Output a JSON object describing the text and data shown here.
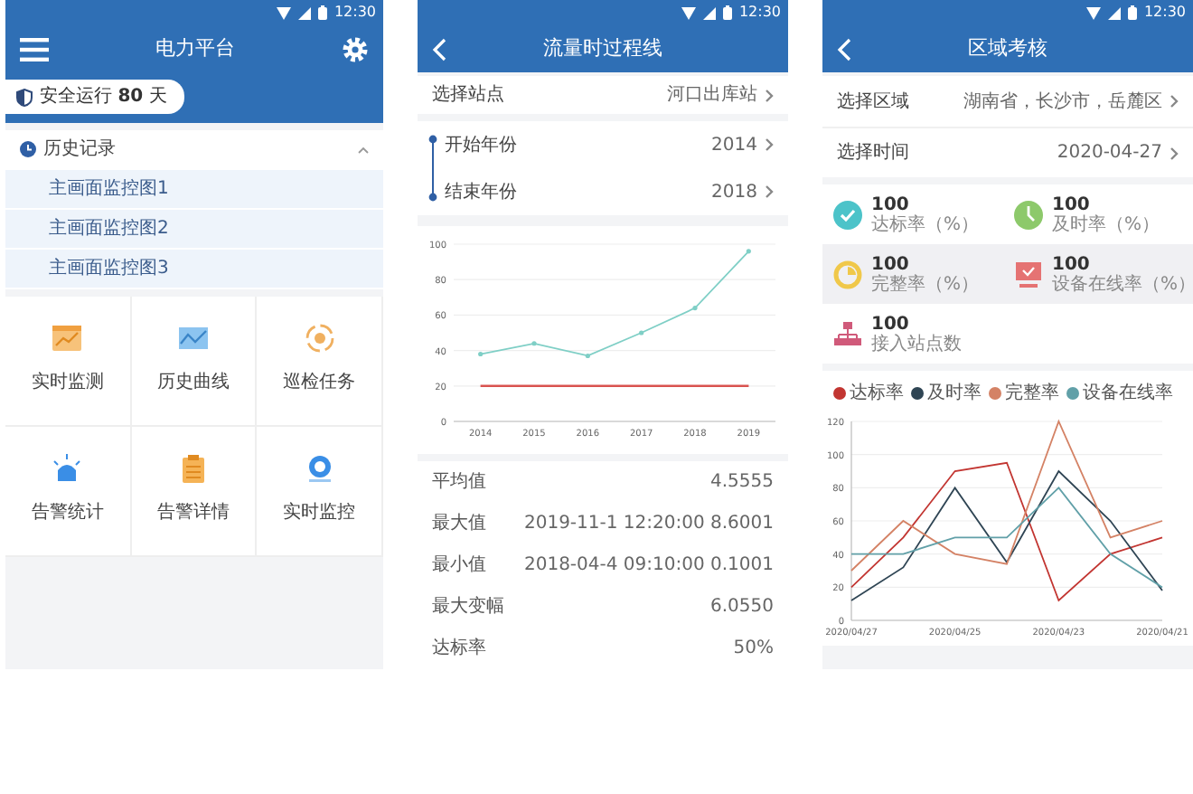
{
  "home": {
    "status_bar": {
      "time": "12:30"
    },
    "title": "电力平台",
    "safety_badge": "安全运行 **80** 天",
    "history": {
      "title": "历史记录",
      "expanded": true,
      "items": [
        "主画面监控图1",
        "主画面监控图2",
        "主画面监控图3"
      ]
    },
    "tiles": [
      {
        "label": "实时监测",
        "kind": "board"
      },
      {
        "label": "历史曲线",
        "kind": "curve"
      },
      {
        "label": "巡检任务",
        "kind": "eye"
      },
      {
        "label": "告警统计",
        "kind": "siren"
      },
      {
        "label": "告警详情",
        "kind": "clipboard"
      },
      {
        "label": "实时监控",
        "kind": "camera"
      }
    ]
  },
  "flow_screen": {
    "status_bar": {
      "time": "12:30"
    },
    "title": "流量时过程线",
    "station": {
      "label": "选择站点",
      "value": "河口出库站"
    },
    "start_year": {
      "label": "开始年份",
      "value": "2014"
    },
    "end_year": {
      "label": "结束年份",
      "value": "2018"
    },
    "chart_data": {
      "type": "line",
      "grid": true,
      "categories": [
        "2014",
        "2015",
        "2016",
        "2017",
        "2018",
        "2019"
      ],
      "ylim": [
        0,
        100
      ],
      "yticks": [
        0,
        20,
        40,
        60,
        80,
        100
      ],
      "series": [
        {
          "color": "#7fcfc6",
          "values": [
            38,
            44,
            37,
            50,
            64,
            96
          ]
        },
        {
          "color": "#d9534f",
          "values": [
            20,
            20,
            20,
            20,
            20,
            20
          ]
        }
      ]
    },
    "stats": [
      {
        "label": "平均值",
        "value": "4.5555"
      },
      {
        "label": "最大值",
        "time": "2019-11-1 12:20:00",
        "value": "8.6001"
      },
      {
        "label": "最小值",
        "time": "2018-04-4 09:10:00",
        "value": "0.1001"
      },
      {
        "label": "最大变幅",
        "value": "6.0550"
      },
      {
        "label": "达标率",
        "value": "50%"
      }
    ]
  },
  "region_screen": {
    "status_bar": {
      "time": "12:30"
    },
    "title": "区域考核",
    "region": {
      "label": "选择区域",
      "value": "湖南省，长沙市，岳麓区"
    },
    "time": {
      "label": "选择时间",
      "value": "2020-04-27"
    },
    "metrics": [
      {
        "value": "100",
        "label": "达标率（%）",
        "kind": "check"
      },
      {
        "value": "100",
        "label": "及时率（%）",
        "kind": "clock"
      },
      {
        "value": "100",
        "label": "完整率（%）",
        "kind": "pie"
      },
      {
        "value": "100",
        "label": "设备在线率（%）",
        "kind": "monitor"
      },
      {
        "value": "100",
        "label": "接入站点数",
        "kind": "network"
      }
    ],
    "chart_data": {
      "type": "line",
      "grid": true,
      "categories": [
        "2020/04/27",
        null,
        "2020/04/25",
        null,
        "2020/04/23",
        null,
        "2020/04/21"
      ],
      "ylim": [
        0,
        120
      ],
      "yticks": [
        0,
        20,
        40,
        60,
        80,
        100,
        120
      ],
      "series": [
        {
          "name": "达标率",
          "color": "#c23531",
          "values": [
            20,
            50,
            90,
            95,
            12,
            40,
            50
          ]
        },
        {
          "name": "及时率",
          "color": "#2f4554",
          "values": [
            12,
            32,
            80,
            35,
            90,
            60,
            18
          ]
        },
        {
          "name": "完整率",
          "color": "#d48265",
          "values": [
            30,
            60,
            40,
            34,
            120,
            50,
            60
          ]
        },
        {
          "name": "设备在线率",
          "color": "#61a0a8",
          "values": [
            40,
            40,
            50,
            50,
            80,
            40,
            20
          ]
        }
      ]
    }
  }
}
